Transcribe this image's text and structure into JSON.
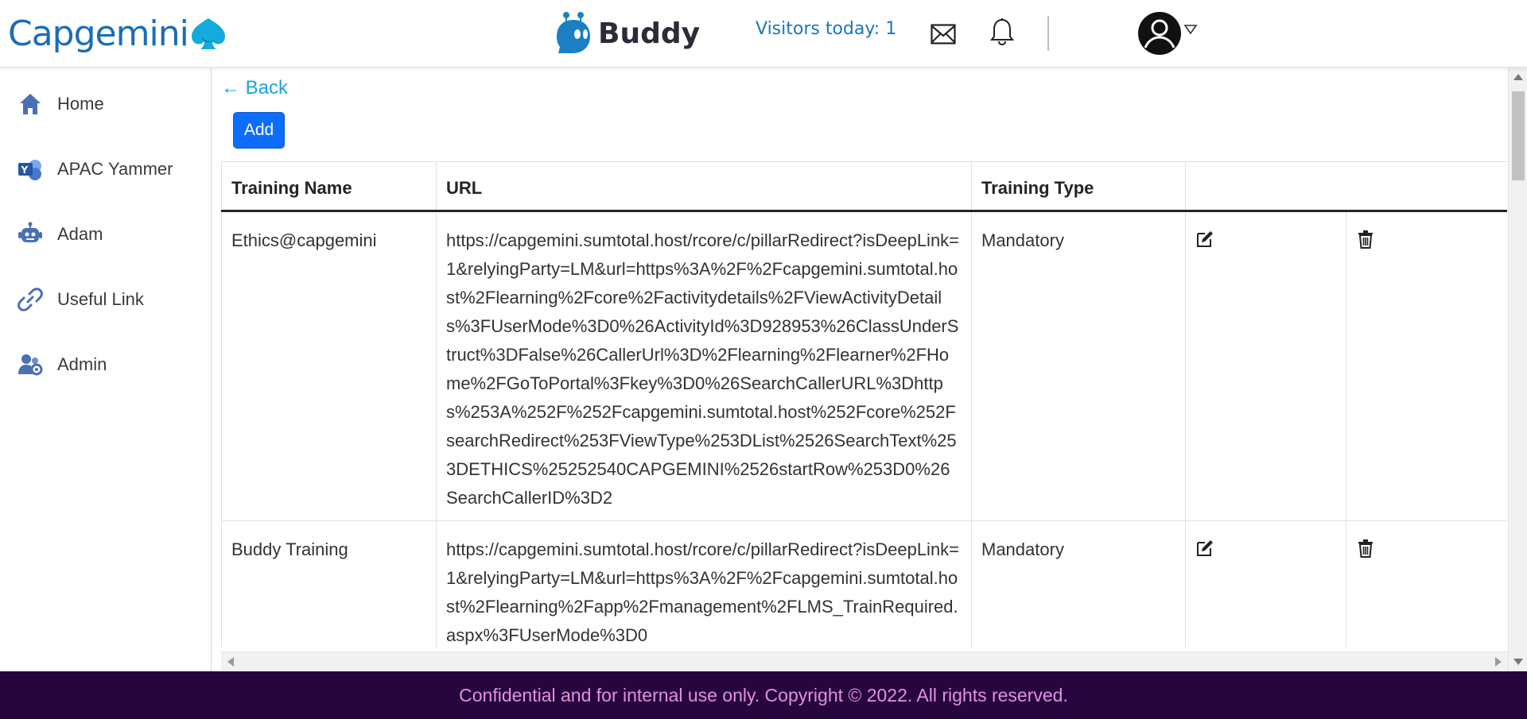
{
  "header": {
    "brand": "Capgemini",
    "app_name": "Buddy",
    "visitors": "Visitors today: 1"
  },
  "sidebar": {
    "items": [
      {
        "label": "Home",
        "icon": "home-icon"
      },
      {
        "label": "APAC Yammer",
        "icon": "yammer-icon"
      },
      {
        "label": "Adam",
        "icon": "robot-icon"
      },
      {
        "label": "Useful Link",
        "icon": "link-icon"
      },
      {
        "label": "Admin",
        "icon": "admin-users-icon"
      }
    ]
  },
  "main": {
    "back_label": "← Back",
    "add_label": "Add",
    "table": {
      "headers": [
        "Training Name",
        "URL",
        "Training Type",
        ""
      ],
      "rows": [
        {
          "name": "Ethics@capgemini",
          "url": "https://capgemini.sumtotal.host/rcore/c/pillarRedirect?isDeepLink=1&relyingParty=LM&url=https%3A%2F%2Fcapgemini.sumtotal.host%2Flearning%2Fcore%2Factivitydetails%2FViewActivityDetails%3FUserMode%3D0%26ActivityId%3D928953%26ClassUnderStruct%3DFalse%26CallerUrl%3D%2Flearning%2Flearner%2FHome%2FGoToPortal%3Fkey%3D0%26SearchCallerURL%3Dhttps%253A%252F%252Fcapgemini.sumtotal.host%252Fcore%252FsearchRedirect%253FViewType%253DList%2526SearchText%253DETHICS%25252540CAPGEMINI%2526startRow%253D0%26SearchCallerID%3D2",
          "type": "Mandatory"
        },
        {
          "name": "Buddy Training",
          "url": "https://capgemini.sumtotal.host/rcore/c/pillarRedirect?isDeepLink=1&relyingParty=LM&url=https%3A%2F%2Fcapgemini.sumtotal.host%2Flearning%2Fapp%2Fmanagement%2FLMS_TrainRequired.aspx%3FUserMode%3D0",
          "type": "Mandatory"
        }
      ]
    }
  },
  "footer": {
    "text": "Confidential and for internal use only. Copyright © 2022. All rights reserved."
  },
  "colors": {
    "brand_blue": "#1b6db8",
    "accent_button": "#0d6efd",
    "back_link": "#1aa3dd",
    "footer_bg": "#27063d",
    "footer_text": "#e38fe6"
  }
}
